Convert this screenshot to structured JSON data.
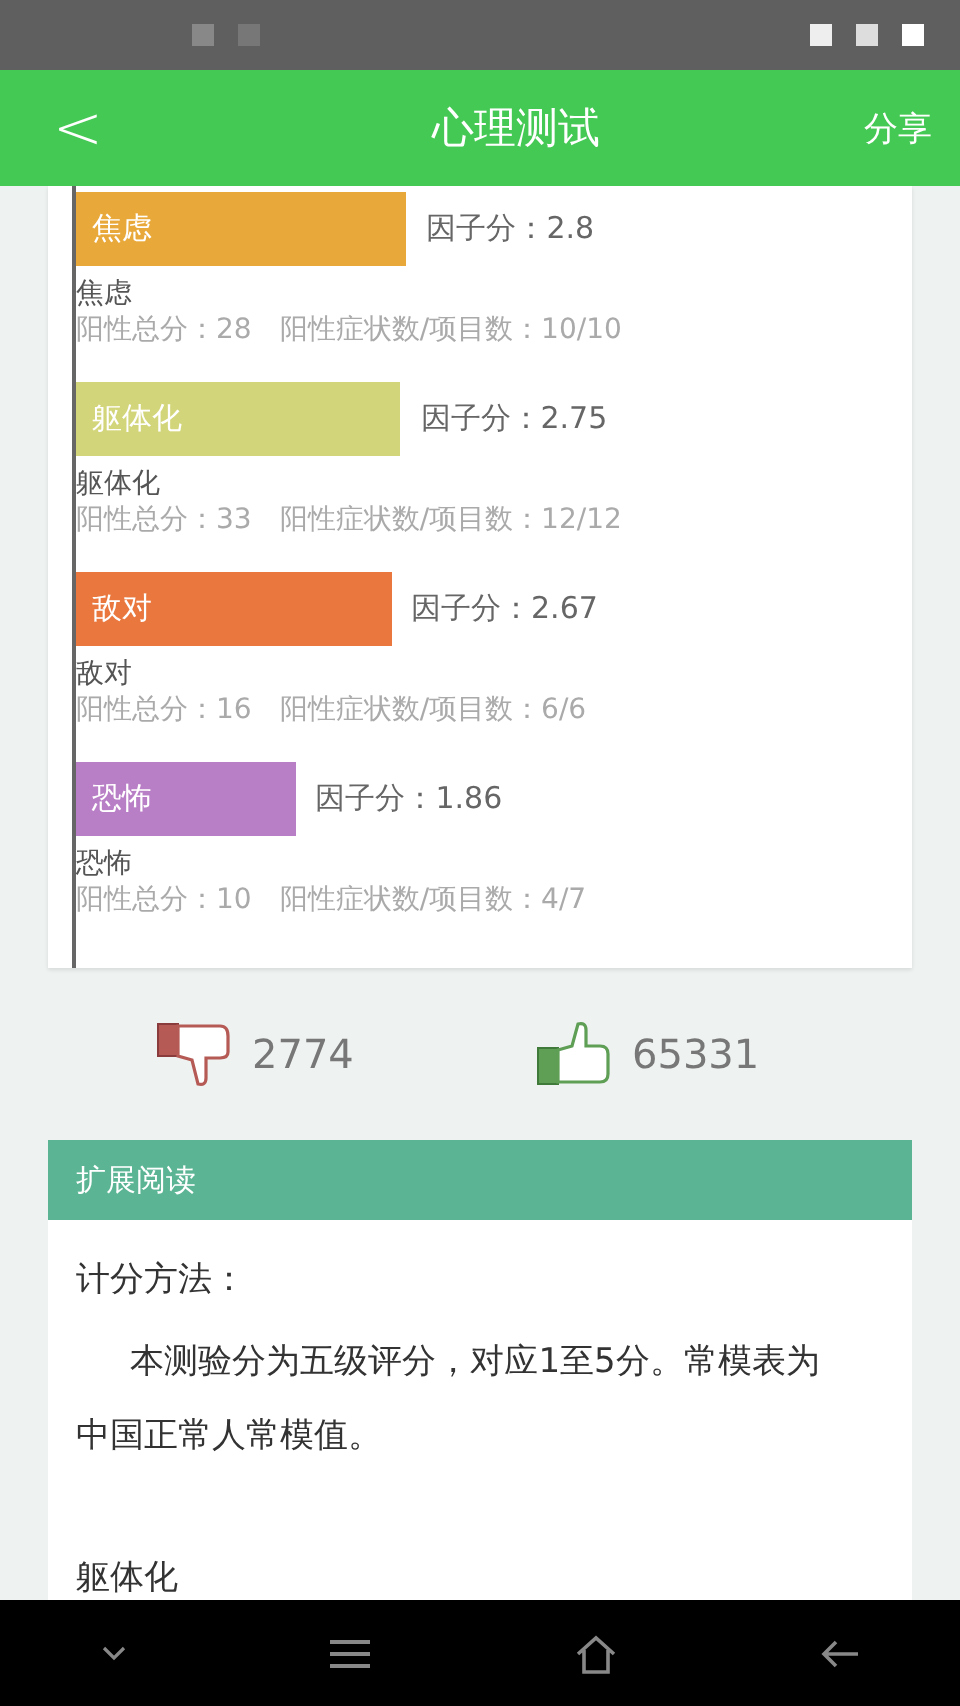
{
  "header": {
    "back": "<",
    "title": "心理测试",
    "action": "分享"
  },
  "chart_data": {
    "type": "bar",
    "orientation": "horizontal",
    "categories": [
      "焦虑",
      "躯体化",
      "敌对",
      "恐怖"
    ],
    "values": [
      2.8,
      2.75,
      2.67,
      1.86
    ],
    "value_labels": [
      "因子分：2.8",
      "因子分：2.75",
      "因子分：2.67",
      "因子分：1.86"
    ]
  },
  "factors": [
    {
      "name": "焦虑",
      "color": "#e9a93a",
      "stats": "阳性总分：28　阳性症状数/项目数：10/10"
    },
    {
      "name": "躯体化",
      "color": "#d3d57a",
      "stats": "阳性总分：33　阳性症状数/项目数：12/12"
    },
    {
      "name": "敌对",
      "color": "#e9773e",
      "stats": "阳性总分：16　阳性症状数/项目数：6/6"
    },
    {
      "name": "恐怖",
      "color": "#b97fc6",
      "stats": "阳性总分：10　阳性症状数/项目数：4/7"
    }
  ],
  "votes": {
    "dislikes": "2774",
    "likes": "65331"
  },
  "reading": {
    "title": "扩展阅读",
    "heading": "计分方法：",
    "paragraph": "本测验分为五级评分，对应1至5分。常模表为中国正常人常模值。",
    "subheading": "躯体化"
  }
}
